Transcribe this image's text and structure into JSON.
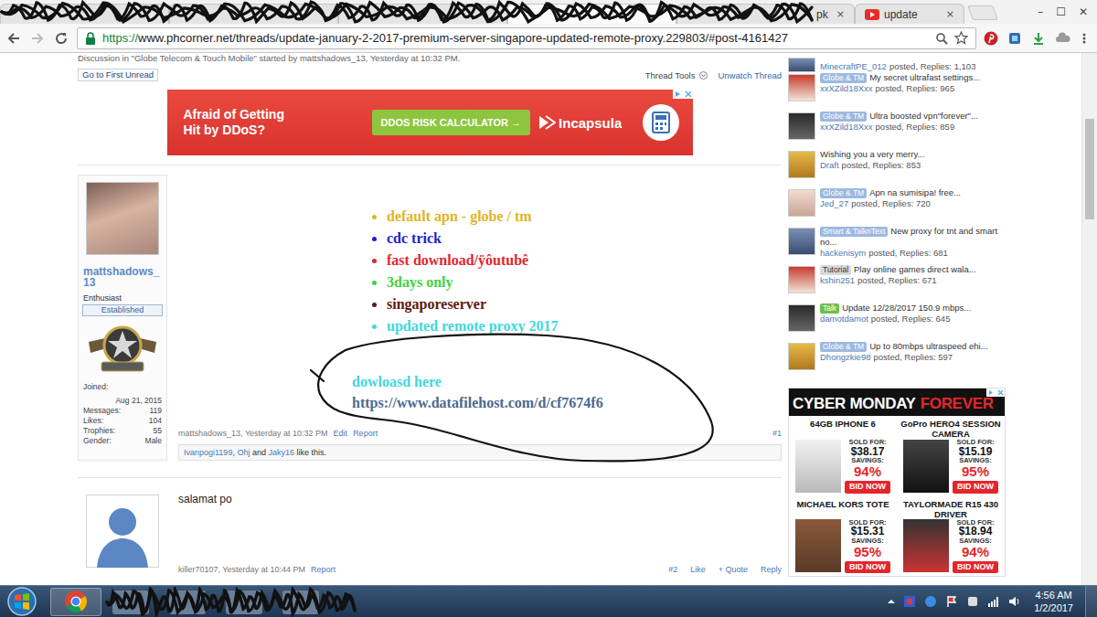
{
  "browser": {
    "tabs": [
      {
        "kind": "redacted",
        "selected": false
      },
      {
        "kind": "redacted",
        "selected": false
      },
      {
        "kind": "redacted",
        "selected": false
      },
      {
        "kind": "redacted",
        "selected": true
      },
      {
        "kind": "page",
        "icon": "none",
        "label": "pk",
        "close": "×",
        "selected": false
      },
      {
        "kind": "page",
        "icon": "youtube",
        "label": "update",
        "close": "×",
        "selected": false
      }
    ],
    "window_controls": [
      "–",
      "☐",
      "✕"
    ],
    "url_scheme": "https://",
    "url_rest": "www.phcorner.net/threads/update-january-2-2017-premium-server-singapore-updated-remote-proxy.229803/#post-4161427"
  },
  "thread": {
    "breadcrumb": "Discussion in \"Globe Telecom & Touch Mobile\" started by mattshadows_13, Yesterday at 10:32 PM.",
    "first_unread": "Go to First Unread",
    "thread_tools": "Thread Tools",
    "unwatch": "Unwatch Thread"
  },
  "banner_ad": {
    "headline": "Afraid of Getting Hit by DDoS?",
    "button": "DDOS RISK CALCULATOR →",
    "brand": "Incapsula"
  },
  "first_post": {
    "author": "mattshadows_13",
    "rank": "Enthusiast",
    "badge": "Established",
    "stats": [
      {
        "kind": "stacked",
        "label": "Joined:",
        "value": "Aug 21, 2015"
      },
      {
        "kind": "inline",
        "label": "Messages:",
        "value": "119"
      },
      {
        "kind": "inline",
        "label": "Likes:",
        "value": "104"
      },
      {
        "kind": "inline",
        "label": "Trophies:",
        "value": "55"
      },
      {
        "kind": "inline",
        "label": "Gender:",
        "value": "Male"
      }
    ],
    "lines": [
      {
        "text": "default apn - globe / tm",
        "color": "#e0b424"
      },
      {
        "text": "cdc trick",
        "color": "#1f1fcf"
      },
      {
        "text": "fast download/ÿôutubê",
        "color": "#e3262d"
      },
      {
        "text": "3days only",
        "color": "#3fd23f"
      },
      {
        "text": "singaporeserver",
        "color": "#5c1a10"
      },
      {
        "text": "updated remote proxy 2017",
        "color": "#3ed8e2"
      }
    ],
    "download_label": "dowloasd here",
    "download_link": "https://www.datafilehost.com/d/cf7674f6",
    "meta": "mattshadows_13, Yesterday at 10:32 PM",
    "actions": [
      "Edit",
      "Report"
    ],
    "number": "#1",
    "likes": [
      {
        "text": "Ivanpogi1199",
        "link": true
      },
      {
        "text": ", ",
        "link": false
      },
      {
        "text": "Ohj",
        "link": true
      },
      {
        "text": " and ",
        "link": false
      },
      {
        "text": "Jaky16",
        "link": true
      },
      {
        "text": " like this.",
        "link": false
      }
    ]
  },
  "second_post": {
    "text": "salamat po",
    "meta": "killer70107, Yesterday at 10:44 PM",
    "actions_left": [
      "Report"
    ],
    "number": "#2",
    "actions_right": [
      "Like",
      "+ Quote",
      "Reply"
    ]
  },
  "sidebar": {
    "items": [
      {
        "kind": "cut",
        "author": "MinecraftPE_012",
        "meta": "posted, Replies: 1,103"
      },
      {
        "kind": "tagged",
        "tag": "Globe & TM",
        "color": "#9cb9e0",
        "title": "My secret ultrafast settings...",
        "author": "xxXZild18Xxx",
        "meta": "posted, Replies: 965"
      },
      {
        "kind": "tagged",
        "tag": "Globe & TM",
        "color": "#9cb9e0",
        "title": "Ultra boosted vpn\"forever\"...",
        "author": "xxXZild18Xxx",
        "meta": "posted, Replies: 859"
      },
      {
        "kind": "plain",
        "title": "Wishing you a very merry...",
        "author": "Draft",
        "meta": "posted, Replies: 853"
      },
      {
        "kind": "tagged",
        "tag": "Globe & TM",
        "color": "#9cb9e0",
        "title": "Apn na sumisipa! free...",
        "author": "Jed_27",
        "meta": "posted, Replies: 720"
      },
      {
        "kind": "tagged",
        "tag": "Smart & TalknText",
        "color": "#9cb9e0",
        "title": "New proxy for tnt and smart no...",
        "author": "hackenisym",
        "meta": "posted, Replies: 681"
      },
      {
        "kind": "tagged",
        "tag": "Tutorial",
        "color": "#d9d9d9",
        "title": "Play online games direct wala...",
        "author": "kshin251",
        "meta": "posted, Replies: 671"
      },
      {
        "kind": "tagged",
        "tag": "Talk",
        "color": "#6cbf4a",
        "title": "Update 12/28/2017 150.9 mbps...",
        "author": "damotdamot",
        "meta": "posted, Replies: 645"
      },
      {
        "kind": "tagged",
        "tag": "Globe & TM",
        "color": "#9cb9e0",
        "title": "Up to 80mbps ultraspeed ehi...",
        "author": "Dhongzkie98",
        "meta": "posted, Replies: 597"
      }
    ]
  },
  "side_ad": {
    "headline": "CYBER MONDAY",
    "headline_accent": "FOREVER",
    "products": [
      {
        "name": "64GB IPHONE 6",
        "sold_label": "SOLD FOR:",
        "price": "$38.17",
        "savings_label": "SAVINGS:",
        "savings": "94%",
        "button": "BID NOW"
      },
      {
        "name": "GoPro HERO4 SESSION CAMERA",
        "sold_label": "SOLD FOR:",
        "price": "$15.19",
        "savings_label": "SAVINGS:",
        "savings": "95%",
        "button": "BID NOW"
      },
      {
        "name": "MICHAEL KORS TOTE",
        "sold_label": "SOLD FOR:",
        "price": "$15.31",
        "savings_label": "SAVINGS:",
        "savings": "95%",
        "button": "BID NOW"
      },
      {
        "name": "TAYLORMADE R15 430 DRIVER",
        "sold_label": "SOLD FOR:",
        "price": "$18.94",
        "savings_label": "SAVINGS:",
        "savings": "94%",
        "button": "BID NOW"
      }
    ]
  },
  "taskbar": {
    "time": "4:56 AM",
    "date": "1/2/2017"
  }
}
